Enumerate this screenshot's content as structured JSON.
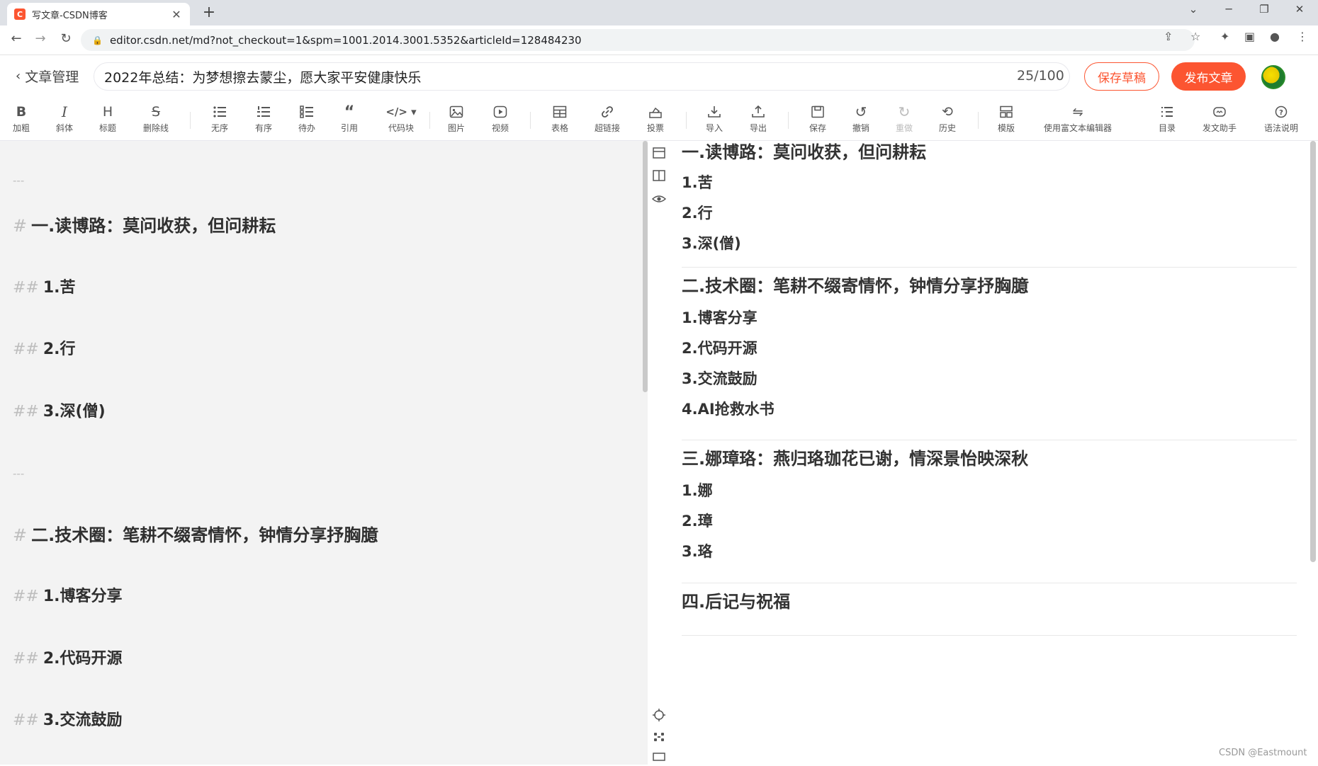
{
  "browser": {
    "tab_title": "写文章-CSDN博客",
    "tab_favicon": "C",
    "new_tab": "+",
    "close_tab": "✕",
    "url": "editor.csdn.net/md?not_checkout=1&spm=1001.2014.3001.5352&articleId=128484230"
  },
  "header": {
    "back_label": "文章管理",
    "title_value": "2022年总结：为梦想擦去蒙尘，愿大家平安健康快乐",
    "title_count": "25/100",
    "save_draft": "保存草稿",
    "publish": "发布文章"
  },
  "toolbar": {
    "bold": "加粗",
    "italic": "斜体",
    "heading": "标题",
    "strike": "删除线",
    "unordered": "无序",
    "ordered": "有序",
    "todo": "待办",
    "quote": "引用",
    "codeblock": "代码块",
    "image": "图片",
    "video": "视频",
    "table": "表格",
    "link": "超链接",
    "vote": "投票",
    "import": "导入",
    "export": "导出",
    "save": "保存",
    "undo": "撤销",
    "redo": "重做",
    "history": "历史",
    "template": "模版",
    "richtext": "使用富文本编辑器",
    "toc": "目录",
    "assistant": "发文助手",
    "syntax": "语法说明",
    "glyph_bold": "B",
    "glyph_italic": "I",
    "glyph_heading": "H",
    "glyph_strike": "S"
  },
  "editor": {
    "hr": "---",
    "h1_mark": "#",
    "h2_mark": "##",
    "lines": [
      {
        "kind": "hr"
      },
      {
        "kind": "h1",
        "text": "一.读博路：莫问收获，但问耕耘"
      },
      {
        "kind": "h2",
        "text": "1.苦"
      },
      {
        "kind": "h2",
        "text": "2.行"
      },
      {
        "kind": "h2",
        "text": "3.深(僧)"
      },
      {
        "kind": "hr"
      },
      {
        "kind": "h1",
        "text": "二.技术圈：笔耕不缀寄情怀，钟情分享抒胸臆"
      },
      {
        "kind": "h2",
        "text": "1.博客分享"
      },
      {
        "kind": "h2",
        "text": "2.代码开源"
      },
      {
        "kind": "h2",
        "text": "3.交流鼓励"
      }
    ]
  },
  "preview": {
    "items": [
      {
        "kind": "h1",
        "text": "一.读博路：莫问收获，但问耕耘"
      },
      {
        "kind": "h2",
        "text": "1.苦"
      },
      {
        "kind": "h2",
        "text": "2.行"
      },
      {
        "kind": "h2",
        "text": "3.深(僧)"
      },
      {
        "kind": "rule"
      },
      {
        "kind": "h1",
        "text": "二.技术圈：笔耕不缀寄情怀，钟情分享抒胸臆"
      },
      {
        "kind": "h2",
        "text": "1.博客分享"
      },
      {
        "kind": "h2",
        "text": "2.代码开源"
      },
      {
        "kind": "h2",
        "text": "3.交流鼓励"
      },
      {
        "kind": "h2",
        "text": "4.AI抢救水书"
      },
      {
        "kind": "rule"
      },
      {
        "kind": "h1",
        "text": "三.娜璋珞：燕归珞珈花已谢，情深景怡映深秋"
      },
      {
        "kind": "h2",
        "text": "1.娜"
      },
      {
        "kind": "h2",
        "text": "2.璋"
      },
      {
        "kind": "h2",
        "text": "3.珞"
      },
      {
        "kind": "rule"
      },
      {
        "kind": "h1",
        "text": "四.后记与祝福"
      },
      {
        "kind": "rule"
      }
    ]
  },
  "watermark": "CSDN @Eastmount",
  "colors": {
    "accent": "#fc5531",
    "editor_bg": "#f3f3f3",
    "markdown_mark": "#bdbdbd"
  }
}
